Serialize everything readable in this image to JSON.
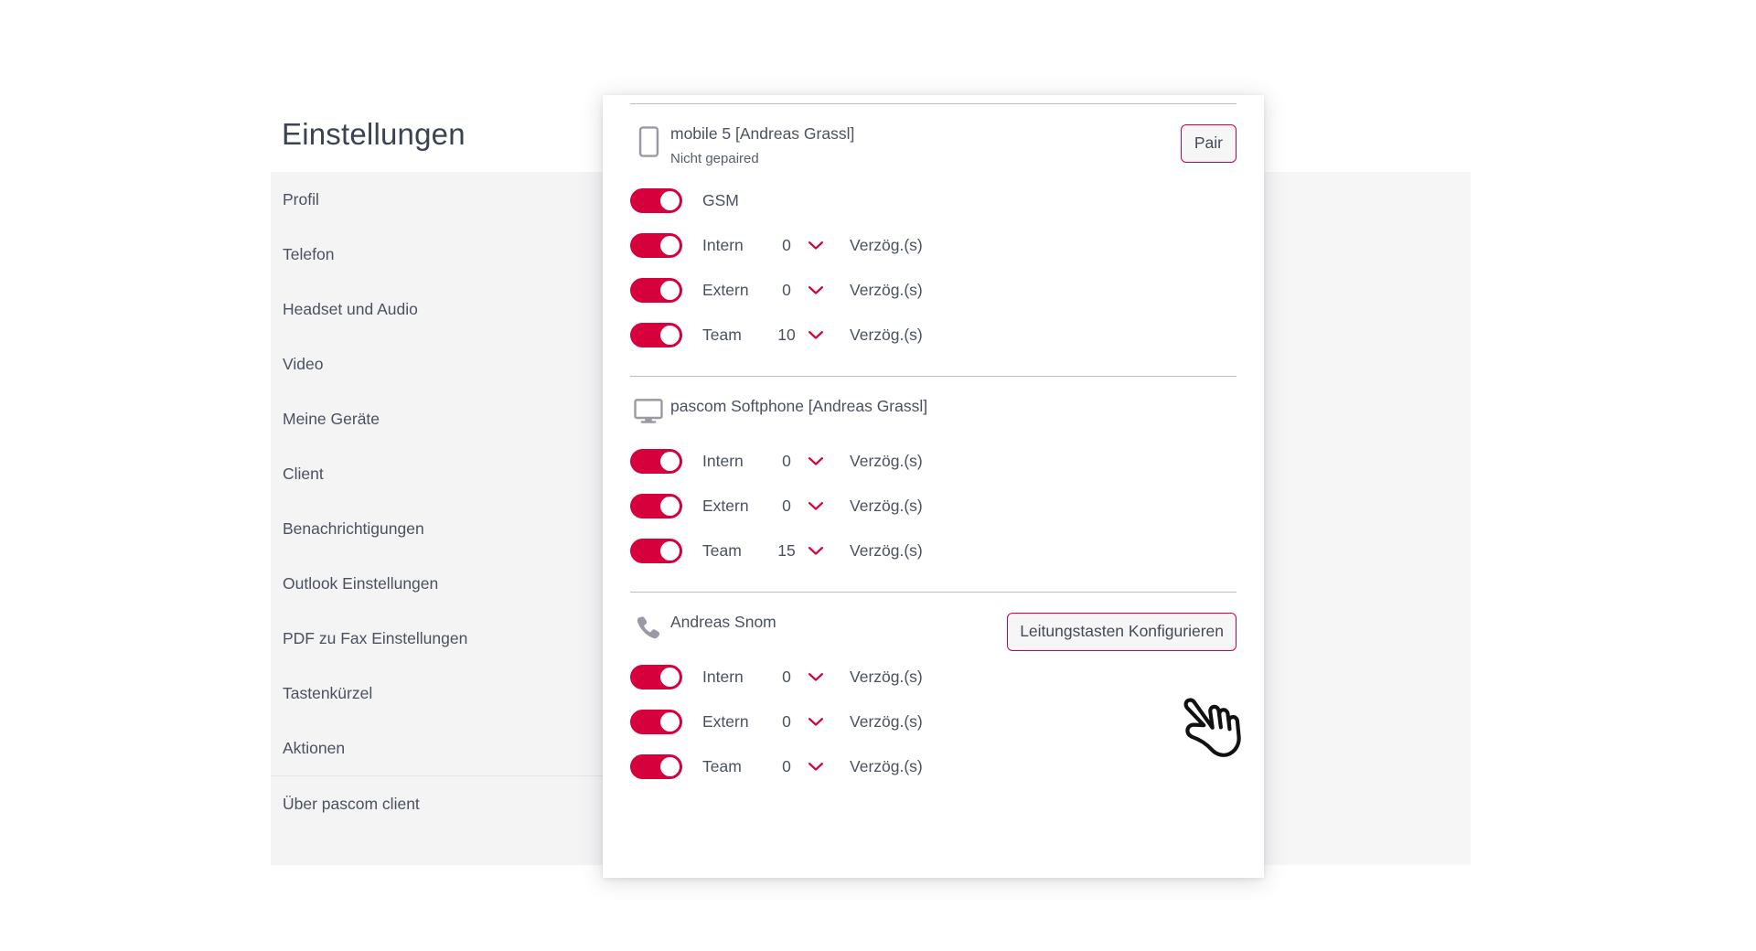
{
  "page": {
    "title": "Einstellungen"
  },
  "sidebar": {
    "items": [
      {
        "label": "Profil"
      },
      {
        "label": "Telefon"
      },
      {
        "label": "Headset und Audio"
      },
      {
        "label": "Video"
      },
      {
        "label": "Meine Geräte"
      },
      {
        "label": "Client"
      },
      {
        "label": "Benachrichtigungen"
      },
      {
        "label": "Outlook Einstellungen"
      },
      {
        "label": "PDF zu Fax Einstellungen"
      },
      {
        "label": "Tastenkürzel"
      },
      {
        "label": "Aktionen"
      },
      {
        "label": "Über pascom client"
      }
    ],
    "divider_after_index": 10
  },
  "modal": {
    "devices": [
      {
        "icon": "mobile-phone-icon",
        "name": "mobile 5 [Andreas Grassl]",
        "status": "Nicht gepaired",
        "action_label": "Pair",
        "action_name": "pair-button",
        "rows": [
          {
            "label": "GSM",
            "enabled": true,
            "has_delay": false
          },
          {
            "label": "Intern",
            "enabled": true,
            "has_delay": true,
            "value": "0",
            "unit": "Verzög.(s)"
          },
          {
            "label": "Extern",
            "enabled": true,
            "has_delay": true,
            "value": "0",
            "unit": "Verzög.(s)"
          },
          {
            "label": "Team",
            "enabled": true,
            "has_delay": true,
            "value": "10",
            "unit": "Verzög.(s)"
          }
        ]
      },
      {
        "icon": "desktop-monitor-icon",
        "name": "pascom Softphone [Andreas Grassl]",
        "status": "",
        "action_label": "",
        "action_name": "",
        "rows": [
          {
            "label": "Intern",
            "enabled": true,
            "has_delay": true,
            "value": "0",
            "unit": "Verzög.(s)"
          },
          {
            "label": "Extern",
            "enabled": true,
            "has_delay": true,
            "value": "0",
            "unit": "Verzög.(s)"
          },
          {
            "label": "Team",
            "enabled": true,
            "has_delay": true,
            "value": "15",
            "unit": "Verzög.(s)"
          }
        ]
      },
      {
        "icon": "desk-phone-icon",
        "name": "Andreas Snom",
        "status": "",
        "action_label": "Leitungstasten Konfigurieren",
        "action_name": "configure-line-keys-button",
        "rows": [
          {
            "label": "Intern",
            "enabled": true,
            "has_delay": true,
            "value": "0",
            "unit": "Verzög.(s)"
          },
          {
            "label": "Extern",
            "enabled": true,
            "has_delay": true,
            "value": "0",
            "unit": "Verzög.(s)"
          },
          {
            "label": "Team",
            "enabled": true,
            "has_delay": true,
            "value": "0",
            "unit": "Verzög.(s)"
          }
        ]
      }
    ]
  },
  "cursor": {
    "icon": "pointing-hand-cursor"
  },
  "colors": {
    "accent": "#d6003c",
    "text": "#4a5160",
    "panel": "#f4f4f5",
    "divider": "#bcbcc8"
  }
}
